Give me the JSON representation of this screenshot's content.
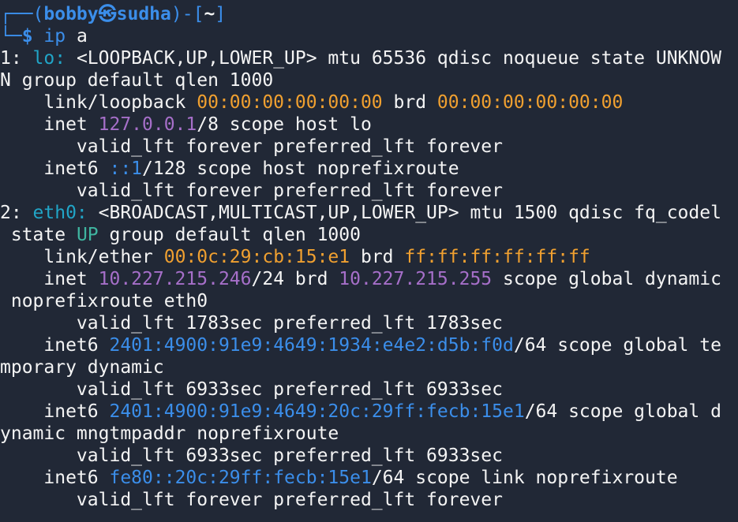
{
  "prompt": {
    "top_left": "┌──(",
    "user": "bobby",
    "at_symbol": "㉿",
    "host": "sudha",
    "mid": ")-[",
    "cwd": "~",
    "end": "]",
    "bottom_left": "└─",
    "dollar": "$",
    "command": "ip",
    "argument": "a"
  },
  "lines": [
    {
      "segments": [
        [
          "1: ",
          ""
        ],
        [
          "lo:",
          "c-cyan"
        ],
        [
          " <LOOPBACK,UP,LOWER_UP> mtu 65536 qdisc noqueue state UNKNOW",
          ""
        ]
      ]
    },
    {
      "segments": [
        [
          "N group default qlen 1000",
          ""
        ]
      ]
    },
    {
      "segments": [
        [
          "    link/loopback ",
          ""
        ],
        [
          "00:00:00:00:00:00",
          "c-orange"
        ],
        [
          " brd ",
          ""
        ],
        [
          "00:00:00:00:00:00",
          "c-orange"
        ]
      ]
    },
    {
      "segments": [
        [
          "    inet ",
          ""
        ],
        [
          "127.0.0.1",
          "c-purple"
        ],
        [
          "/8 scope host lo",
          ""
        ]
      ]
    },
    {
      "segments": [
        [
          "       valid_lft forever preferred_lft forever",
          ""
        ]
      ]
    },
    {
      "segments": [
        [
          "    inet6 ",
          ""
        ],
        [
          "::1",
          "c-blue"
        ],
        [
          "/128 scope host noprefixroute",
          ""
        ]
      ]
    },
    {
      "segments": [
        [
          "       valid_lft forever preferred_lft forever",
          ""
        ]
      ]
    },
    {
      "segments": [
        [
          "2: ",
          ""
        ],
        [
          "eth0:",
          "c-cyan"
        ],
        [
          " <BROADCAST,MULTICAST,UP,LOWER_UP> mtu 1500 qdisc fq_codel",
          ""
        ]
      ]
    },
    {
      "segments": [
        [
          " state ",
          ""
        ],
        [
          "UP",
          "c-green"
        ],
        [
          " group default qlen 1000",
          ""
        ]
      ]
    },
    {
      "segments": [
        [
          "    link/ether ",
          ""
        ],
        [
          "00:0c:29:cb:15:e1",
          "c-orange"
        ],
        [
          " brd ",
          ""
        ],
        [
          "ff:ff:ff:ff:ff:ff",
          "c-orange"
        ]
      ]
    },
    {
      "segments": [
        [
          "    inet ",
          ""
        ],
        [
          "10.227.215.246",
          "c-purple"
        ],
        [
          "/24 brd ",
          ""
        ],
        [
          "10.227.215.255",
          "c-purple"
        ],
        [
          " scope global dynamic",
          ""
        ]
      ]
    },
    {
      "segments": [
        [
          " noprefixroute eth0",
          ""
        ]
      ]
    },
    {
      "segments": [
        [
          "       valid_lft 1783sec preferred_lft 1783sec",
          ""
        ]
      ]
    },
    {
      "segments": [
        [
          "    inet6 ",
          ""
        ],
        [
          "2401:4900:91e9:4649:1934:e4e2:d5b:f0d",
          "c-blue"
        ],
        [
          "/64 scope global te",
          ""
        ]
      ]
    },
    {
      "segments": [
        [
          "mporary dynamic",
          ""
        ]
      ]
    },
    {
      "segments": [
        [
          "       valid_lft 6933sec preferred_lft 6933sec",
          ""
        ]
      ]
    },
    {
      "segments": [
        [
          "    inet6 ",
          ""
        ],
        [
          "2401:4900:91e9:4649:20c:29ff:fecb:15e1",
          "c-blue"
        ],
        [
          "/64 scope global d",
          ""
        ]
      ]
    },
    {
      "segments": [
        [
          "ynamic mngtmpaddr noprefixroute",
          ""
        ]
      ]
    },
    {
      "segments": [
        [
          "       valid_lft 6933sec preferred_lft 6933sec",
          ""
        ]
      ]
    },
    {
      "segments": [
        [
          "    inet6 ",
          ""
        ],
        [
          "fe80::20c:29ff:fecb:15e1",
          "c-blue"
        ],
        [
          "/64 scope link noprefixroute",
          ""
        ]
      ]
    },
    {
      "segments": [
        [
          "       valid_lft forever preferred_lft forever",
          ""
        ]
      ]
    }
  ],
  "colors": {
    "background": "#212836",
    "foreground": "#f4f4f4",
    "interface": "#21a5c7",
    "mac": "#f0a030",
    "ipv4": "#a66fc9",
    "ipv6": "#3b8eea",
    "state_up": "#3fb5a0",
    "prompt": "#3b8eea"
  }
}
